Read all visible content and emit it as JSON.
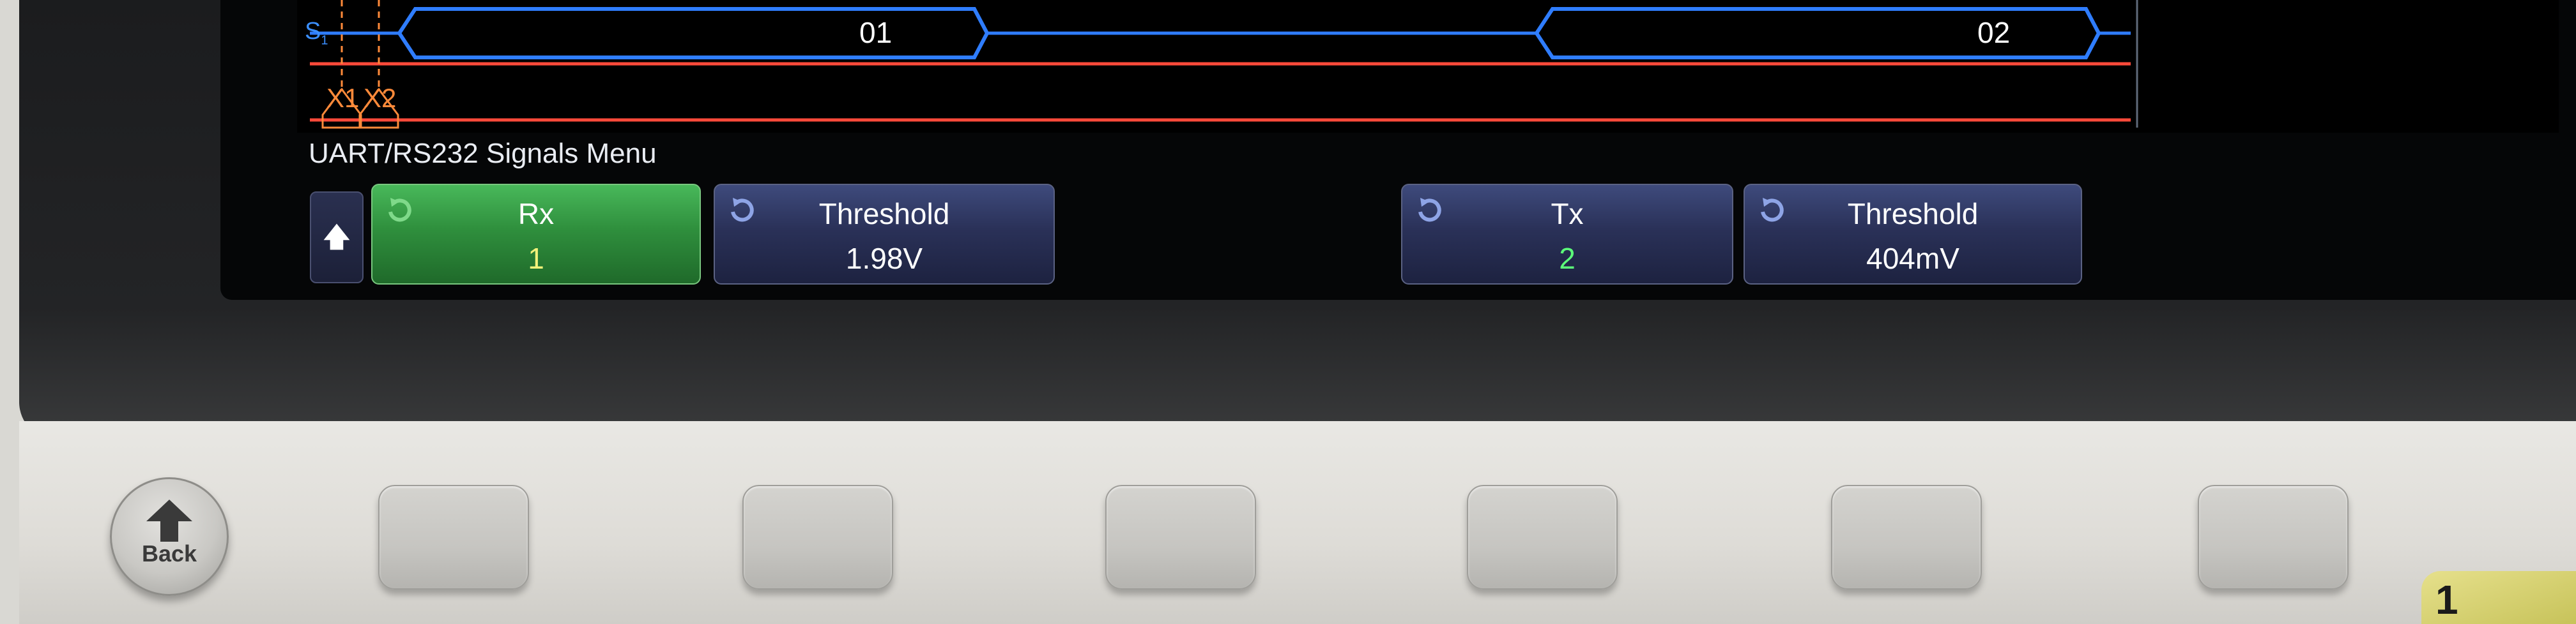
{
  "waveform": {
    "signal_label": "S",
    "signal_subscript": "1",
    "decodes": [
      "01",
      "02"
    ],
    "cursors": [
      "X1",
      "X2"
    ],
    "colors": {
      "bus": "#2f7dff",
      "lane": "#ff4a3a",
      "cursor": "#ff8a3a"
    }
  },
  "menu": {
    "title": "UART/RS232 Signals Menu",
    "up_icon": "up-arrow-icon",
    "softkeys": [
      {
        "label": "Rx",
        "value": "1"
      },
      {
        "label": "Threshold",
        "value": "1.98V"
      },
      {
        "label": "Tx",
        "value": "2"
      },
      {
        "label": "Threshold",
        "value": "404mV"
      }
    ]
  },
  "front_panel": {
    "back_label": "Back",
    "channel_marker": "1"
  }
}
